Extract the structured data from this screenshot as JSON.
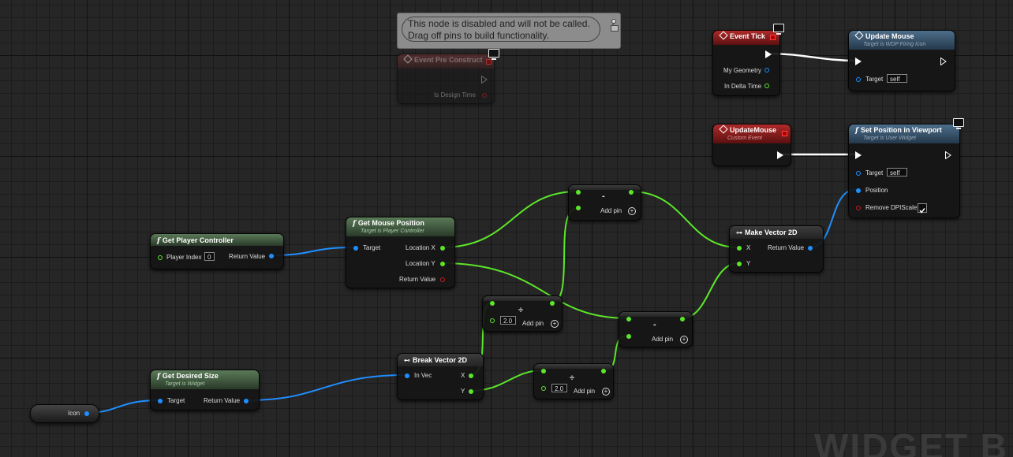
{
  "tooltip": {
    "line1": "This node is disabled and will not be called.",
    "line2": "Drag off pins to build functionality."
  },
  "watermark": "WIDGET B",
  "nodes": {
    "event_pre_construct": {
      "title": "Event Pre Construct",
      "pin_is_design_time": "Is Design Time"
    },
    "event_tick": {
      "title": "Event Tick",
      "pin_my_geometry": "My Geometry",
      "pin_in_delta_time": "In Delta Time"
    },
    "update_mouse_call": {
      "title": "Update Mouse",
      "subtitle": "Target is WDP Firing Icon",
      "pin_target": "Target",
      "target_value": "self"
    },
    "update_mouse_event": {
      "title": "UpdateMouse",
      "subtitle": "Custom Event"
    },
    "set_position": {
      "title": "Set Position in Viewport",
      "subtitle": "Target is User Widget",
      "pin_target": "Target",
      "target_value": "self",
      "pin_position": "Position",
      "pin_remove_dpi": "Remove DPIScale"
    },
    "get_player_controller": {
      "title": "Get Player Controller",
      "pin_player_index": "Player Index",
      "player_index_value": "0",
      "pin_return": "Return Value"
    },
    "get_mouse_position": {
      "title": "Get Mouse Position",
      "subtitle": "Target is Player Controller",
      "pin_target": "Target",
      "pin_location_x": "Location X",
      "pin_location_y": "Location Y",
      "pin_return": "Return Value"
    },
    "subtract_top": {
      "op": "-",
      "add_pin": "Add pin"
    },
    "make_vector_2d": {
      "title": "Make Vector 2D",
      "pin_x": "X",
      "pin_y": "Y",
      "pin_return": "Return Value"
    },
    "divide_top": {
      "op": "÷",
      "value": "2.0",
      "add_pin": "Add pin"
    },
    "subtract_bottom": {
      "op": "-",
      "add_pin": "Add pin"
    },
    "break_vector_2d": {
      "title": "Break Vector 2D",
      "pin_in_vec": "In Vec",
      "pin_x": "X",
      "pin_y": "Y"
    },
    "divide_bottom": {
      "op": "÷",
      "value": "2.0",
      "add_pin": "Add pin"
    },
    "get_desired_size": {
      "title": "Get Desired Size",
      "subtitle": "Target is Widget",
      "pin_target": "Target",
      "pin_return": "Return Value"
    },
    "icon_var": {
      "label": "Icon"
    }
  },
  "colors": {
    "float_pin": "#5ce62a",
    "struct_pin": "#1f8fff",
    "exec_pin": "#ffffff",
    "bool_pin": "#c02020",
    "function_header": "#4d6e8a",
    "pure_header": "#5a7a58",
    "event_header": "#b02a2a"
  }
}
